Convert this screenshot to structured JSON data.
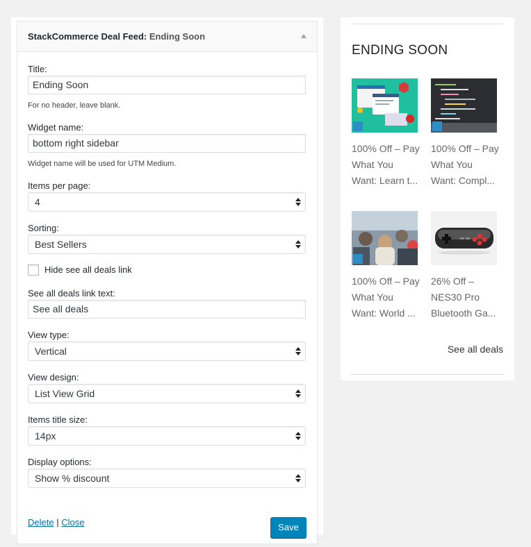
{
  "widget": {
    "title_prefix": "StackCommerce Deal Feed:",
    "title_suffix": "Ending Soon",
    "fields": {
      "title_label": "Title:",
      "title_value": "Ending Soon",
      "title_desc": "For no header, leave blank.",
      "widget_name_label": "Widget name:",
      "widget_name_value": "bottom right sidebar",
      "widget_name_desc": "Widget name will be used for UTM Medium.",
      "items_per_page_label": "Items per page:",
      "items_per_page_value": "4",
      "sorting_label": "Sorting:",
      "sorting_value": "Best Sellers",
      "hide_link_label": "Hide see all deals link",
      "hide_link_checked": false,
      "see_all_text_label": "See all deals link text:",
      "see_all_text_value": "See all deals",
      "view_type_label": "View type:",
      "view_type_value": "Vertical",
      "view_design_label": "View design:",
      "view_design_value": "List View Grid",
      "title_size_label": "Items title size:",
      "title_size_value": "14px",
      "display_options_label": "Display options:",
      "display_options_value": "Show % discount"
    },
    "actions": {
      "delete_label": "Delete",
      "separator": "|",
      "close_label": "Close",
      "save_label": "Save"
    }
  },
  "preview": {
    "heading": "ENDING SOON",
    "deals": [
      {
        "lines": [
          "100% Off – Pay",
          "What You",
          "Want: Learn t..."
        ],
        "image": "coding-course-thumbnail"
      },
      {
        "lines": [
          "100% Off – Pay",
          "What You",
          "Want: Compl..."
        ],
        "image": "code-screen-thumbnail"
      },
      {
        "lines": [
          "100% Off – Pay",
          "What You",
          "Want: World ..."
        ],
        "image": "travel-crowd-thumbnail"
      },
      {
        "lines": [
          "26% Off –",
          "NES30 Pro",
          "Bluetooth Ga..."
        ],
        "image": "gamepad-thumbnail"
      }
    ],
    "see_all_label": "See all deals"
  },
  "colors": {
    "background": "#f1f1f1",
    "primary_button": "#0085ba",
    "link": "#0073aa"
  }
}
